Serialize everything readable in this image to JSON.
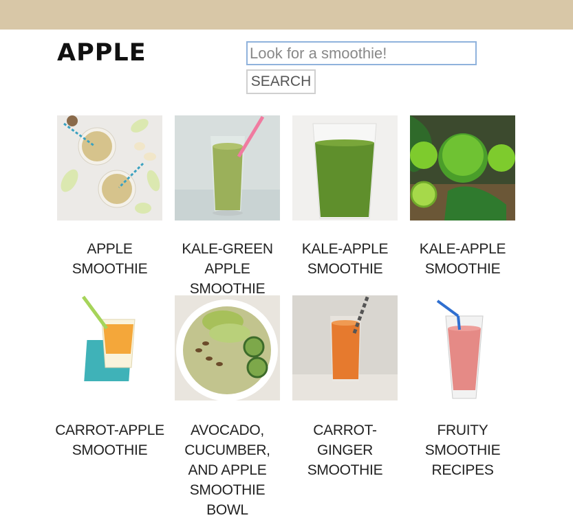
{
  "header": {
    "logo": "APPLE"
  },
  "search": {
    "placeholder": "Look for a smoothie!",
    "button_label": "SEARCH"
  },
  "results": [
    {
      "title": "APPLE SMOOTHIE",
      "image_icon": "apple-smoothie-photo"
    },
    {
      "title": "KALE-GREEN APPLE SMOOTHIE",
      "image_icon": "kale-green-apple-smoothie-photo"
    },
    {
      "title": "KALE-APPLE SMOOTHIE",
      "image_icon": "kale-apple-smoothie-photo"
    },
    {
      "title": "KALE-APPLE SMOOTHIE",
      "image_icon": "kale-apple-smoothie-photo"
    },
    {
      "title": "CARROT-APPLE SMOOTHIE",
      "image_icon": "carrot-apple-smoothie-photo"
    },
    {
      "title": "AVOCADO, CUCUMBER, AND APPLE SMOOTHIE BOWL",
      "image_icon": "smoothie-bowl-photo"
    },
    {
      "title": "CARROT-GINGER SMOOTHIE",
      "image_icon": "carrot-ginger-smoothie-photo"
    },
    {
      "title": "FRUITY SMOOTHIE RECIPES",
      "image_icon": "fruity-smoothie-photo"
    }
  ],
  "colors": {
    "top_bar": "#d8c7a7",
    "input_border": "#8fb2dc",
    "button_border": "#cfcfcf"
  }
}
